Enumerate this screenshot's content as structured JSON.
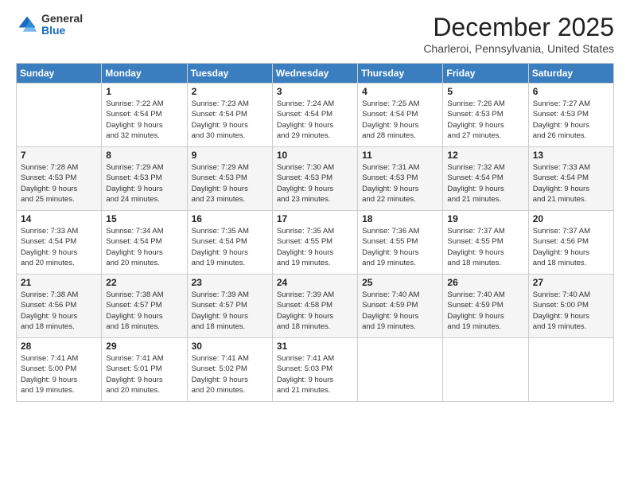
{
  "header": {
    "logo_general": "General",
    "logo_blue": "Blue",
    "title": "December 2025",
    "location": "Charleroi, Pennsylvania, United States"
  },
  "weekdays": [
    "Sunday",
    "Monday",
    "Tuesday",
    "Wednesday",
    "Thursday",
    "Friday",
    "Saturday"
  ],
  "weeks": [
    [
      {
        "day": "",
        "info": ""
      },
      {
        "day": "1",
        "info": "Sunrise: 7:22 AM\nSunset: 4:54 PM\nDaylight: 9 hours\nand 32 minutes."
      },
      {
        "day": "2",
        "info": "Sunrise: 7:23 AM\nSunset: 4:54 PM\nDaylight: 9 hours\nand 30 minutes."
      },
      {
        "day": "3",
        "info": "Sunrise: 7:24 AM\nSunset: 4:54 PM\nDaylight: 9 hours\nand 29 minutes."
      },
      {
        "day": "4",
        "info": "Sunrise: 7:25 AM\nSunset: 4:54 PM\nDaylight: 9 hours\nand 28 minutes."
      },
      {
        "day": "5",
        "info": "Sunrise: 7:26 AM\nSunset: 4:53 PM\nDaylight: 9 hours\nand 27 minutes."
      },
      {
        "day": "6",
        "info": "Sunrise: 7:27 AM\nSunset: 4:53 PM\nDaylight: 9 hours\nand 26 minutes."
      }
    ],
    [
      {
        "day": "7",
        "info": "Sunrise: 7:28 AM\nSunset: 4:53 PM\nDaylight: 9 hours\nand 25 minutes."
      },
      {
        "day": "8",
        "info": "Sunrise: 7:29 AM\nSunset: 4:53 PM\nDaylight: 9 hours\nand 24 minutes."
      },
      {
        "day": "9",
        "info": "Sunrise: 7:29 AM\nSunset: 4:53 PM\nDaylight: 9 hours\nand 23 minutes."
      },
      {
        "day": "10",
        "info": "Sunrise: 7:30 AM\nSunset: 4:53 PM\nDaylight: 9 hours\nand 23 minutes."
      },
      {
        "day": "11",
        "info": "Sunrise: 7:31 AM\nSunset: 4:53 PM\nDaylight: 9 hours\nand 22 minutes."
      },
      {
        "day": "12",
        "info": "Sunrise: 7:32 AM\nSunset: 4:54 PM\nDaylight: 9 hours\nand 21 minutes."
      },
      {
        "day": "13",
        "info": "Sunrise: 7:33 AM\nSunset: 4:54 PM\nDaylight: 9 hours\nand 21 minutes."
      }
    ],
    [
      {
        "day": "14",
        "info": "Sunrise: 7:33 AM\nSunset: 4:54 PM\nDaylight: 9 hours\nand 20 minutes."
      },
      {
        "day": "15",
        "info": "Sunrise: 7:34 AM\nSunset: 4:54 PM\nDaylight: 9 hours\nand 20 minutes."
      },
      {
        "day": "16",
        "info": "Sunrise: 7:35 AM\nSunset: 4:54 PM\nDaylight: 9 hours\nand 19 minutes."
      },
      {
        "day": "17",
        "info": "Sunrise: 7:35 AM\nSunset: 4:55 PM\nDaylight: 9 hours\nand 19 minutes."
      },
      {
        "day": "18",
        "info": "Sunrise: 7:36 AM\nSunset: 4:55 PM\nDaylight: 9 hours\nand 19 minutes."
      },
      {
        "day": "19",
        "info": "Sunrise: 7:37 AM\nSunset: 4:55 PM\nDaylight: 9 hours\nand 18 minutes."
      },
      {
        "day": "20",
        "info": "Sunrise: 7:37 AM\nSunset: 4:56 PM\nDaylight: 9 hours\nand 18 minutes."
      }
    ],
    [
      {
        "day": "21",
        "info": "Sunrise: 7:38 AM\nSunset: 4:56 PM\nDaylight: 9 hours\nand 18 minutes."
      },
      {
        "day": "22",
        "info": "Sunrise: 7:38 AM\nSunset: 4:57 PM\nDaylight: 9 hours\nand 18 minutes."
      },
      {
        "day": "23",
        "info": "Sunrise: 7:39 AM\nSunset: 4:57 PM\nDaylight: 9 hours\nand 18 minutes."
      },
      {
        "day": "24",
        "info": "Sunrise: 7:39 AM\nSunset: 4:58 PM\nDaylight: 9 hours\nand 18 minutes."
      },
      {
        "day": "25",
        "info": "Sunrise: 7:40 AM\nSunset: 4:59 PM\nDaylight: 9 hours\nand 19 minutes."
      },
      {
        "day": "26",
        "info": "Sunrise: 7:40 AM\nSunset: 4:59 PM\nDaylight: 9 hours\nand 19 minutes."
      },
      {
        "day": "27",
        "info": "Sunrise: 7:40 AM\nSunset: 5:00 PM\nDaylight: 9 hours\nand 19 minutes."
      }
    ],
    [
      {
        "day": "28",
        "info": "Sunrise: 7:41 AM\nSunset: 5:00 PM\nDaylight: 9 hours\nand 19 minutes."
      },
      {
        "day": "29",
        "info": "Sunrise: 7:41 AM\nSunset: 5:01 PM\nDaylight: 9 hours\nand 20 minutes."
      },
      {
        "day": "30",
        "info": "Sunrise: 7:41 AM\nSunset: 5:02 PM\nDaylight: 9 hours\nand 20 minutes."
      },
      {
        "day": "31",
        "info": "Sunrise: 7:41 AM\nSunset: 5:03 PM\nDaylight: 9 hours\nand 21 minutes."
      },
      {
        "day": "",
        "info": ""
      },
      {
        "day": "",
        "info": ""
      },
      {
        "day": "",
        "info": ""
      }
    ]
  ]
}
